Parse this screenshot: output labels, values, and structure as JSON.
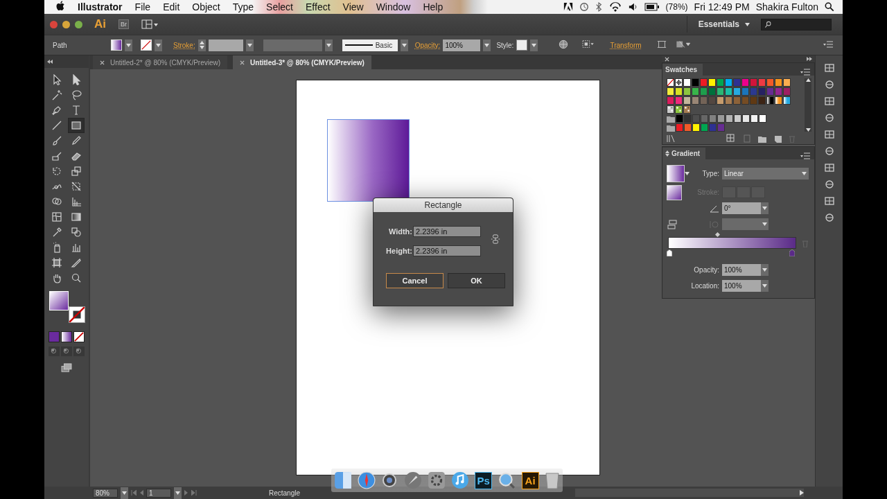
{
  "menu_bar": {
    "app": "Illustrator",
    "items": [
      "File",
      "Edit",
      "Object",
      "Type",
      "Select",
      "Effect",
      "View",
      "Window",
      "Help"
    ],
    "battery": "(78%)",
    "clock": "Fri 12:49 PM",
    "user": "Shakira Fulton"
  },
  "app_bar": {
    "logo": "Ai",
    "bridge": "Br",
    "workspace": "Essentials"
  },
  "control_bar": {
    "selection": "Path",
    "stroke_label": "Stroke:",
    "brush": "Basic",
    "opacity_label": "Opacity:",
    "opacity": "100%",
    "style_label": "Style:",
    "transform": "Transform"
  },
  "tabs": [
    {
      "label": "Untitled-2* @ 80% (CMYK/Preview)",
      "selected": false
    },
    {
      "label": "Untitled-3* @ 80% (CMYK/Preview)",
      "selected": true
    }
  ],
  "tools": [
    {
      "selected": false
    },
    {
      "selected": false
    },
    {
      "selected": false
    },
    {
      "selected": false
    },
    {
      "selected": false
    },
    {
      "selected": false
    },
    {
      "selected": false
    },
    {
      "selected": true
    },
    {
      "selected": false
    },
    {
      "selected": false
    },
    {
      "selected": false
    },
    {
      "selected": false
    },
    {
      "selected": false
    },
    {
      "selected": false
    },
    {
      "selected": false
    },
    {
      "selected": false
    },
    {
      "selected": false
    },
    {
      "selected": false
    },
    {
      "selected": false
    },
    {
      "selected": false
    },
    {
      "selected": false
    },
    {
      "selected": false
    },
    {
      "selected": false
    },
    {
      "selected": false
    },
    {
      "selected": false
    },
    {
      "selected": false
    },
    {
      "selected": false
    },
    {
      "selected": false
    }
  ],
  "dialog": {
    "title": "Rectangle",
    "fields": [
      {
        "label": "Width:",
        "value": "2.2396 in"
      },
      {
        "label": "Height:",
        "value": "2.2396 in"
      }
    ],
    "buttons": [
      {
        "label": "Cancel",
        "focused": true
      },
      {
        "label": "OK",
        "focused": false
      }
    ]
  },
  "swatches": {
    "title": "Swatches",
    "rows": [
      {
        "folder": false,
        "swatches": [
          {
            "kind": "none",
            "color": "#ffffff"
          },
          {
            "kind": "registration",
            "color": "#ffffff"
          },
          {
            "kind": "solid",
            "color": "#ffffff"
          },
          {
            "kind": "solid",
            "color": "#000000"
          },
          {
            "kind": "solid",
            "color": "#ed1c24"
          },
          {
            "kind": "solid",
            "color": "#fff200"
          },
          {
            "kind": "solid",
            "color": "#00a651"
          },
          {
            "kind": "solid",
            "color": "#00aeef"
          },
          {
            "kind": "solid",
            "color": "#2e3192"
          },
          {
            "kind": "solid",
            "color": "#ec008c"
          },
          {
            "kind": "solid",
            "color": "#d2143a"
          },
          {
            "kind": "solid",
            "color": "#ee3a43"
          },
          {
            "kind": "solid",
            "color": "#f15a29"
          },
          {
            "kind": "solid",
            "color": "#f7941d"
          },
          {
            "kind": "solid",
            "color": "#fbad4f"
          }
        ]
      },
      {
        "folder": false,
        "swatches": [
          {
            "kind": "solid",
            "color": "#f1eb3b"
          },
          {
            "kind": "solid",
            "color": "#d7df23"
          },
          {
            "kind": "solid",
            "color": "#8dc63f"
          },
          {
            "kind": "solid",
            "color": "#39b54a"
          },
          {
            "kind": "solid",
            "color": "#1e9e4c"
          },
          {
            "kind": "solid",
            "color": "#00703c"
          },
          {
            "kind": "solid",
            "color": "#2bb673"
          },
          {
            "kind": "solid",
            "color": "#1dbea4"
          },
          {
            "kind": "solid",
            "color": "#27aae1"
          },
          {
            "kind": "solid",
            "color": "#1b75bb"
          },
          {
            "kind": "solid",
            "color": "#2b3990"
          },
          {
            "kind": "solid",
            "color": "#262262"
          },
          {
            "kind": "solid",
            "color": "#662d91"
          },
          {
            "kind": "solid",
            "color": "#92278f"
          },
          {
            "kind": "solid",
            "color": "#9e1f63"
          }
        ]
      },
      {
        "folder": false,
        "swatches": [
          {
            "kind": "solid",
            "color": "#da1c5c"
          },
          {
            "kind": "solid",
            "color": "#ee2a7b"
          },
          {
            "kind": "solid",
            "color": "#c2b59b"
          },
          {
            "kind": "solid",
            "color": "#998675"
          },
          {
            "kind": "solid",
            "color": "#736357"
          },
          {
            "kind": "solid",
            "color": "#534741"
          },
          {
            "kind": "solid",
            "color": "#c69c6d"
          },
          {
            "kind": "solid",
            "color": "#a67c52"
          },
          {
            "kind": "solid",
            "color": "#8c6239"
          },
          {
            "kind": "solid",
            "color": "#754c24"
          },
          {
            "kind": "solid",
            "color": "#603913"
          },
          {
            "kind": "solid",
            "color": "#3c2415"
          },
          {
            "kind": "gradient",
            "color": "#000000"
          },
          {
            "kind": "gradient",
            "color": "#f7941d"
          },
          {
            "kind": "gradient",
            "color": "#27aae1"
          }
        ]
      },
      {
        "folder": false,
        "swatches": [
          {
            "kind": "pattern",
            "color": "#cccccc"
          },
          {
            "kind": "pattern",
            "color": "#8dc63f"
          },
          {
            "kind": "pattern",
            "color": "#a67c52"
          }
        ]
      },
      {
        "folder": true,
        "swatches": [
          {
            "kind": "solid",
            "color": "#000000"
          },
          {
            "kind": "solid",
            "color": "#333333"
          },
          {
            "kind": "solid",
            "color": "#4d4d4d"
          },
          {
            "kind": "solid",
            "color": "#666666"
          },
          {
            "kind": "solid",
            "color": "#808080"
          },
          {
            "kind": "solid",
            "color": "#999999"
          },
          {
            "kind": "solid",
            "color": "#b3b3b3"
          },
          {
            "kind": "solid",
            "color": "#cccccc"
          },
          {
            "kind": "solid",
            "color": "#e6e6e6"
          },
          {
            "kind": "solid",
            "color": "#f2f2f2"
          },
          {
            "kind": "solid",
            "color": "#ffffff"
          }
        ]
      },
      {
        "folder": true,
        "swatches": [
          {
            "kind": "solid",
            "color": "#ed1c24"
          },
          {
            "kind": "solid",
            "color": "#f15a29"
          },
          {
            "kind": "solid",
            "color": "#fff200"
          },
          {
            "kind": "solid",
            "color": "#00a651"
          },
          {
            "kind": "solid",
            "color": "#2e3192"
          },
          {
            "kind": "solid",
            "color": "#662d91"
          }
        ]
      }
    ]
  },
  "gradient": {
    "title": "Gradient",
    "stops": [
      {
        "color": "#ffffff"
      },
      {
        "color": "#5a2a88"
      }
    ],
    "type_label": "Type:",
    "type": "Linear",
    "stroke_label": "Stroke:",
    "angle": "0°",
    "opacity_label": "Opacity:",
    "opacity": "100%",
    "location_label": "Location:",
    "location": "100%"
  },
  "status_bar": {
    "zoom": "80%",
    "page": "1",
    "tool": "Rectangle"
  },
  "dock": [
    {
      "kind": "finder"
    },
    {
      "kind": "safari"
    },
    {
      "kind": "camera"
    },
    {
      "kind": "launchpad"
    },
    {
      "kind": "preferences"
    },
    {
      "kind": "music"
    },
    {
      "kind": "app",
      "label": "Ps",
      "color": "#4fb8f0"
    },
    {
      "kind": "quicktime"
    },
    {
      "kind": "app",
      "label": "Ai",
      "color": "#f7a21b"
    },
    {
      "kind": "trash"
    }
  ]
}
